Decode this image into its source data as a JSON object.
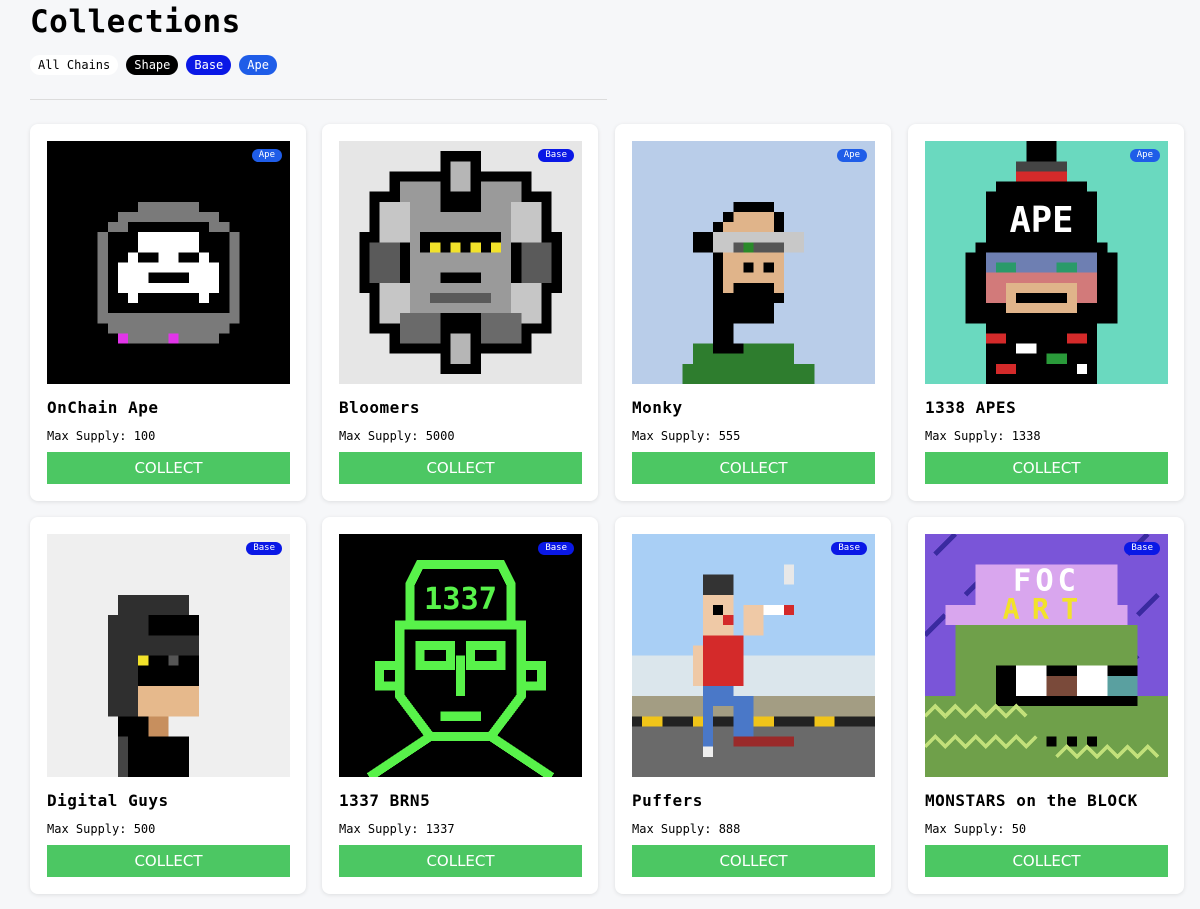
{
  "page": {
    "title": "Collections"
  },
  "filters": [
    {
      "label": "All Chains"
    },
    {
      "label": "Shape"
    },
    {
      "label": "Base"
    },
    {
      "label": "Ape"
    }
  ],
  "colors": {
    "button": "#4cc763",
    "base_badge": "#0a18e6",
    "ape_badge": "#1f5de8"
  },
  "supply_prefix": "Max Supply: ",
  "cards": [
    {
      "name": "OnChain Ape",
      "supply": "Max Supply: 100",
      "chain": "Ape",
      "button": "COLLECT"
    },
    {
      "name": "Bloomers",
      "supply": "Max Supply: 5000",
      "chain": "Base",
      "button": "COLLECT"
    },
    {
      "name": "Monky",
      "supply": "Max Supply: 555",
      "chain": "Ape",
      "button": "COLLECT"
    },
    {
      "name": "1338 APES",
      "supply": "Max Supply: 1338",
      "chain": "Ape",
      "button": "COLLECT"
    },
    {
      "name": "Digital Guys",
      "supply": "Max Supply: 500",
      "chain": "Base",
      "button": "COLLECT"
    },
    {
      "name": "1337 BRN5",
      "supply": "Max Supply: 1337",
      "chain": "Base",
      "button": "COLLECT"
    },
    {
      "name": "Puffers",
      "supply": "Max Supply: 888",
      "chain": "Base",
      "button": "COLLECT"
    },
    {
      "name": "MONSTARS on the BLOCK",
      "supply": "Max Supply: 50",
      "chain": "Base",
      "button": "COLLECT"
    }
  ],
  "artwork_text": {
    "brn5_helmet": "1337",
    "monstars_cap_1": "FOC",
    "monstars_cap_2": "ART",
    "apes_hat": "APE"
  }
}
